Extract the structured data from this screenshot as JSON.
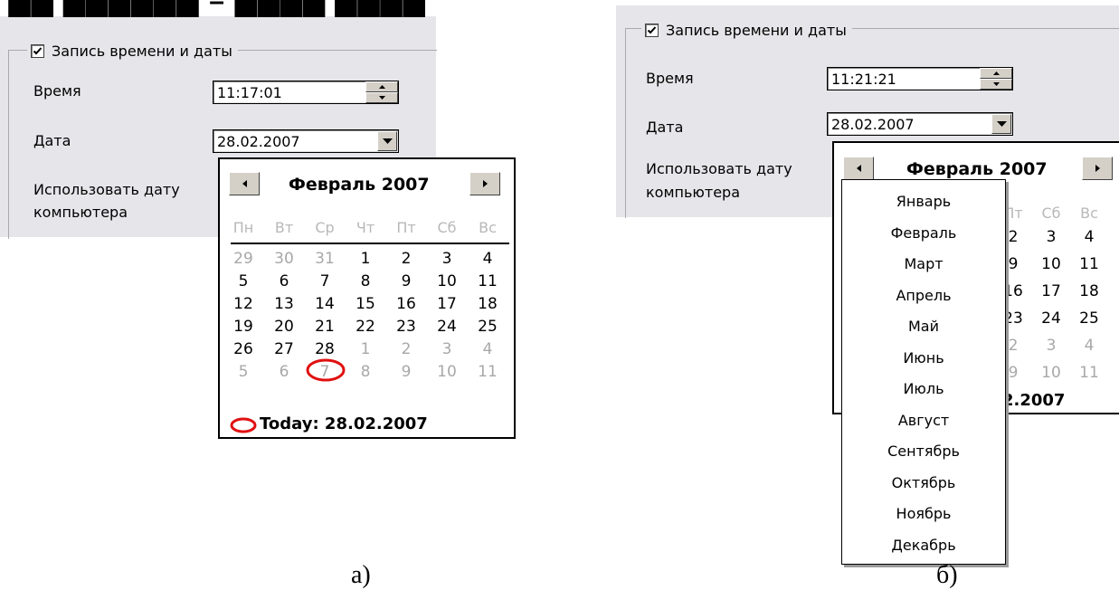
{
  "left": {
    "checkbox_label": "Запись времени и даты",
    "time_label": "Время",
    "time_value": "11:17:01",
    "date_label": "Дата",
    "date_value": "28.02.2007",
    "use_pc_date_line1": "Использовать дату",
    "use_pc_date_line2": "компьютера",
    "calendar": {
      "title": "Февраль 2007",
      "dow": [
        "Пн",
        "Вт",
        "Ср",
        "Чт",
        "Пт",
        "Сб",
        "Вс"
      ],
      "weeks": [
        [
          "29",
          "30",
          "31",
          "1",
          "2",
          "3",
          "4"
        ],
        [
          "5",
          "6",
          "7",
          "8",
          "9",
          "10",
          "11"
        ],
        [
          "12",
          "13",
          "14",
          "15",
          "16",
          "17",
          "18"
        ],
        [
          "19",
          "20",
          "21",
          "22",
          "23",
          "24",
          "25"
        ],
        [
          "26",
          "27",
          "28",
          "1",
          "2",
          "3",
          "4"
        ],
        [
          "5",
          "6",
          "7",
          "8",
          "9",
          "10",
          "11"
        ]
      ],
      "today": "Today: 28.02.2007"
    },
    "caption": "а)"
  },
  "right": {
    "checkbox_label": "Запись времени и даты",
    "time_label": "Время",
    "time_value": "11:21:21",
    "date_label": "Дата",
    "date_value": "28.02.2007",
    "use_pc_date_line1": "Использовать дату",
    "use_pc_date_line2": "компьютера",
    "calendar": {
      "title": "Февраль 2007",
      "dow_partial": [
        "Пт",
        "Сб",
        "Вс"
      ],
      "weeks_partial": [
        [
          "2",
          "3",
          "4"
        ],
        [
          "9",
          "10",
          "11"
        ],
        [
          "16",
          "17",
          "18"
        ],
        [
          "23",
          "24",
          "25"
        ],
        [
          "2",
          "3",
          "4"
        ],
        [
          "9",
          "10",
          "11"
        ]
      ],
      "today_partial": "2.2007"
    },
    "months": [
      "Январь",
      "Февраль",
      "Март",
      "Апрель",
      "Май",
      "Июнь",
      "Июль",
      "Август",
      "Сентябрь",
      "Октябрь",
      "Ноябрь",
      "Декабрь"
    ],
    "caption": "б)"
  },
  "colors": {
    "annotation": "#e01010",
    "panel": "#e6e6ea"
  }
}
